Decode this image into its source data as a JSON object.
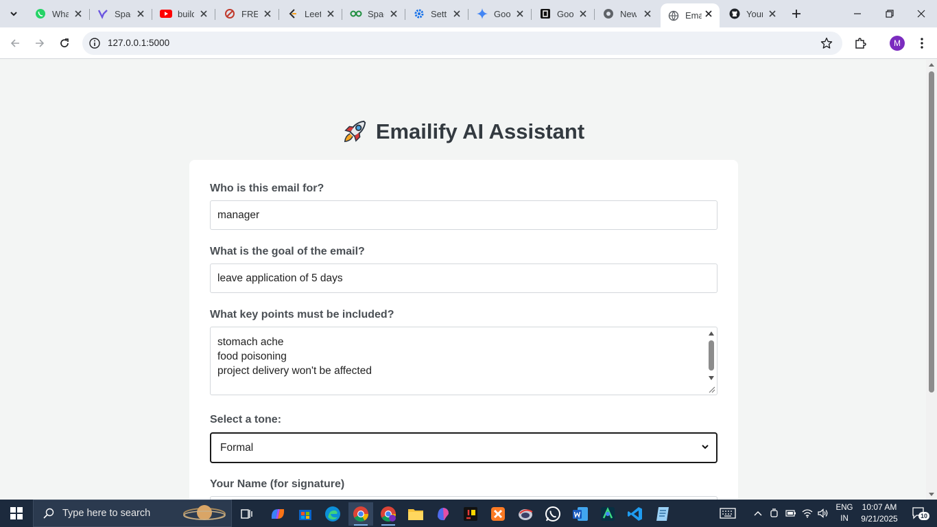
{
  "browser": {
    "tabs": [
      {
        "title": "WhatsApp",
        "icon": "whatsapp-icon"
      },
      {
        "title": "Spaces",
        "icon": "spaces-icon"
      },
      {
        "title": "build",
        "icon": "youtube-icon"
      },
      {
        "title": "FREE",
        "icon": "free-icon"
      },
      {
        "title": "LeetCode",
        "icon": "leetcode-icon"
      },
      {
        "title": "Spaces",
        "icon": "spaces-green-icon"
      },
      {
        "title": "Settings",
        "icon": "gear-icon"
      },
      {
        "title": "Google Gemini",
        "icon": "gemini-icon"
      },
      {
        "title": "Google",
        "icon": "book-icon"
      },
      {
        "title": "New",
        "icon": "new-icon"
      },
      {
        "title": "Emailify",
        "icon": "globe-icon",
        "active": true
      },
      {
        "title": "Your",
        "icon": "github-icon"
      }
    ],
    "url": "127.0.0.1:5000",
    "profile_initial": "M"
  },
  "app": {
    "title": "Emailify AI Assistant",
    "form": {
      "recipient": {
        "label": "Who is this email for?",
        "value": "manager"
      },
      "goal": {
        "label": "What is the goal of the email?",
        "value": "leave application of 5 days"
      },
      "key_points": {
        "label": "What key points must be included?",
        "lines": [
          "stomach ache",
          "food poisoning",
          "project delivery won't be affected"
        ]
      },
      "tone": {
        "label": "Select a tone:",
        "value": "Formal"
      },
      "name": {
        "label": "Your Name (for signature)",
        "value": ""
      }
    }
  },
  "taskbar": {
    "search_placeholder": "Type here to search",
    "language": [
      "ENG",
      "IN"
    ],
    "time": "10:07 AM",
    "date": "9/21/2025",
    "notifications": "10",
    "apps": [
      "task-view-icon",
      "copilot-icon",
      "store-icon",
      "edge-icon",
      "chrome-icon",
      "chrome-profile-icon",
      "file-explorer-icon",
      "m365-icon",
      "ideal-icon",
      "xampp-icon",
      "eclipse-icon",
      "whatsapp-icon",
      "word-icon",
      "android-studio-icon",
      "vscode-icon",
      "notepad-icon"
    ]
  }
}
